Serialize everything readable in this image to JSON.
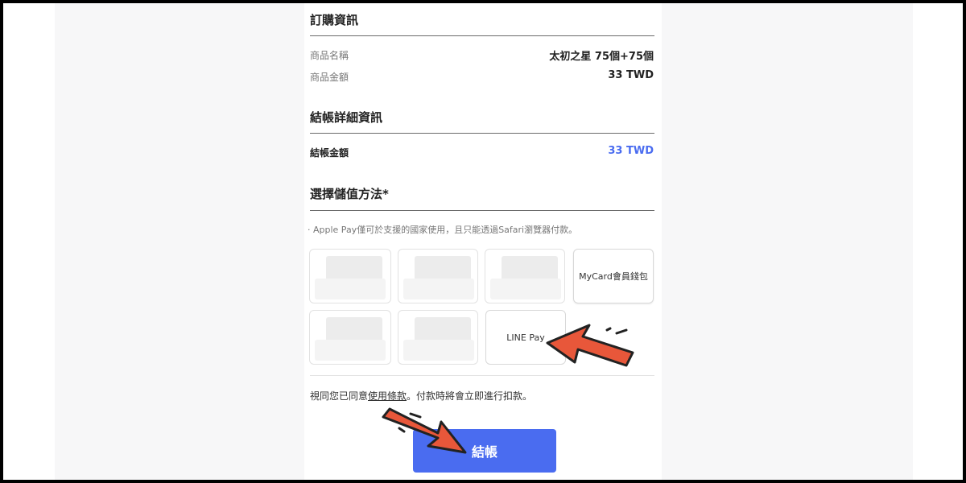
{
  "order_info": {
    "title": "訂購資訊",
    "product_name_label": "商品名稱",
    "product_name_value": "太初之星 75個+75個",
    "product_amount_label": "商品金額",
    "product_amount_value": "33 TWD"
  },
  "checkout_details": {
    "title": "結帳詳細資訊",
    "amount_label": "結帳金額",
    "amount_value": "33 TWD",
    "accent_color": "#4a6cf0"
  },
  "payment_method": {
    "title": "選擇儲值方法*",
    "note": "· Apple Pay僅可於支援的國家使用，且只能透過Safari瀏覽器付款。",
    "options": [
      {
        "label": ""
      },
      {
        "label": ""
      },
      {
        "label": ""
      },
      {
        "label": "MyCard會員錢包"
      },
      {
        "label": ""
      },
      {
        "label": ""
      },
      {
        "label": "LINE Pay"
      }
    ]
  },
  "agreement": {
    "prefix": "視同您已同意",
    "link": "使用條款",
    "suffix": "。付款時將會立即進行扣款。"
  },
  "checkout_button": {
    "label": "結帳",
    "color": "#4a6cf0"
  },
  "annotations": {
    "arrow_color": "#e8573a",
    "arrow_icon_1": "arrow-pointing-line-pay",
    "arrow_icon_2": "arrow-pointing-checkout-button"
  }
}
